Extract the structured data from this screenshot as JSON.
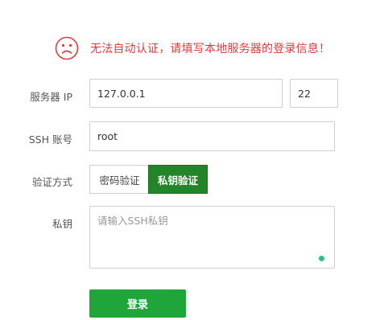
{
  "error": {
    "icon": "sad-face-icon",
    "color": "#e4393c",
    "message": "无法自动认证，请填写本地服务器的登录信息！"
  },
  "form": {
    "server_ip_label": "服务器 IP",
    "server_ip_value": "127.0.0.1",
    "port_value": "22",
    "ssh_account_label": "SSH 账号",
    "ssh_account_value": "root",
    "auth_method_label": "验证方式",
    "auth_options": [
      "密码验证",
      "私钥验证"
    ],
    "auth_selected": "私钥验证",
    "private_key_label": "私钥",
    "private_key_placeholder": "请输入SSH私钥",
    "login_button": "登录"
  },
  "colors": {
    "accent": "#20a53a",
    "selected_segment": "#23852a",
    "status_dot": "#26c281"
  }
}
